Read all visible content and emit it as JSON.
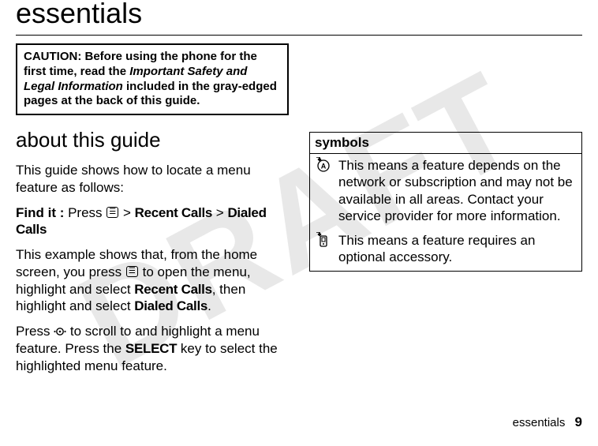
{
  "watermark": "DRAFT",
  "chapter_title": "essentials",
  "caution": {
    "prefix": "CAUTION:",
    "part1": " Before using the phone for the first time, read the ",
    "italic": "Important Safety and Legal Information",
    "part2": " included in the gray-edged pages at the back of this guide."
  },
  "section_title": "about this guide",
  "para1": "This guide shows how to locate a menu feature as follows:",
  "findit": {
    "label": "Find it :",
    "press": " Press ",
    "menu_icon_name": "menu-key",
    "sep": " > ",
    "item1": "Recent Calls",
    "item2": "Dialed Calls"
  },
  "para2a": "This example shows that, from the home screen, you press ",
  "para2b": " to open the menu, highlight and select ",
  "para2c": ", then highlight and select ",
  "para2d": ".",
  "recent_calls": "Recent Calls",
  "dialed_calls": "Dialed Calls",
  "para3a": "Press ",
  "para3b": " to scroll to and highlight a menu feature. Press the ",
  "select_key": "SELECT",
  "para3c": " key to select the highlighted menu feature.",
  "symbols": {
    "header": "symbols",
    "rows": [
      {
        "icon": "network-dependent-icon",
        "text": "This means a feature depends on the network or subscription and may not be available in all areas. Contact your service provider for more information."
      },
      {
        "icon": "accessory-required-icon",
        "text": "This means a feature requires an optional accessory."
      }
    ]
  },
  "footer": {
    "label": "essentials",
    "page": "9"
  }
}
